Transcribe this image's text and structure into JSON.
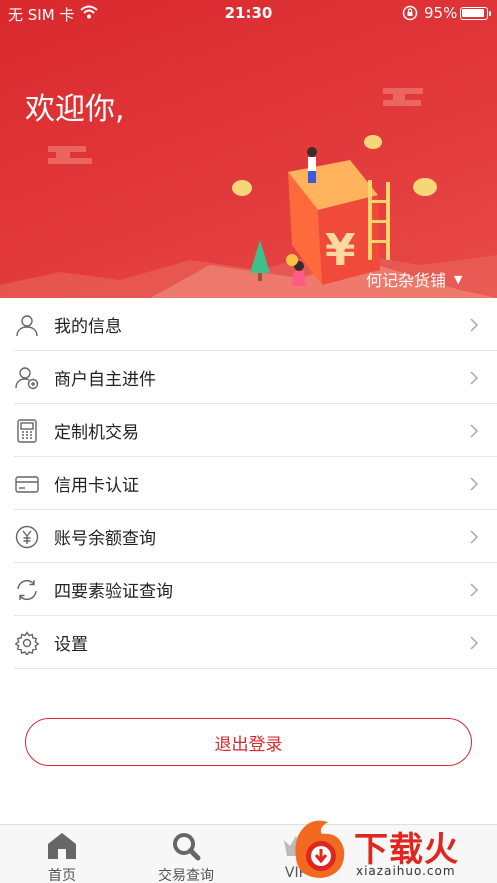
{
  "status_bar": {
    "carrier": "无 SIM 卡",
    "time": "21:30",
    "battery_percent": "95%",
    "battery_level": 0.95
  },
  "header": {
    "welcome": "欢迎你,",
    "shop_name": "何记杂货铺",
    "illustration_symbol": "¥"
  },
  "menu": [
    {
      "label": "我的信息",
      "icon": "user-icon"
    },
    {
      "label": "商户自主进件",
      "icon": "user-add-icon"
    },
    {
      "label": "定制机交易",
      "icon": "pos-terminal-icon"
    },
    {
      "label": "信用卡认证",
      "icon": "credit-card-icon"
    },
    {
      "label": "账号余额查询",
      "icon": "yuan-coin-icon"
    },
    {
      "label": "四要素验证查询",
      "icon": "refresh-icon"
    },
    {
      "label": "设置",
      "icon": "gear-icon"
    }
  ],
  "logout": {
    "label": "退出登录"
  },
  "tabbar": [
    {
      "label": "首页",
      "icon": "home-icon"
    },
    {
      "label": "交易查询",
      "icon": "search-icon"
    },
    {
      "label": "VIP",
      "icon": "vip-icon"
    }
  ],
  "watermark": {
    "title": "下载火",
    "site": "xiazaihuo.com"
  },
  "colors": {
    "brand_red": "#d9292e",
    "divider": "#e5e5e5",
    "tabbar_bg": "#f7f7f7"
  }
}
